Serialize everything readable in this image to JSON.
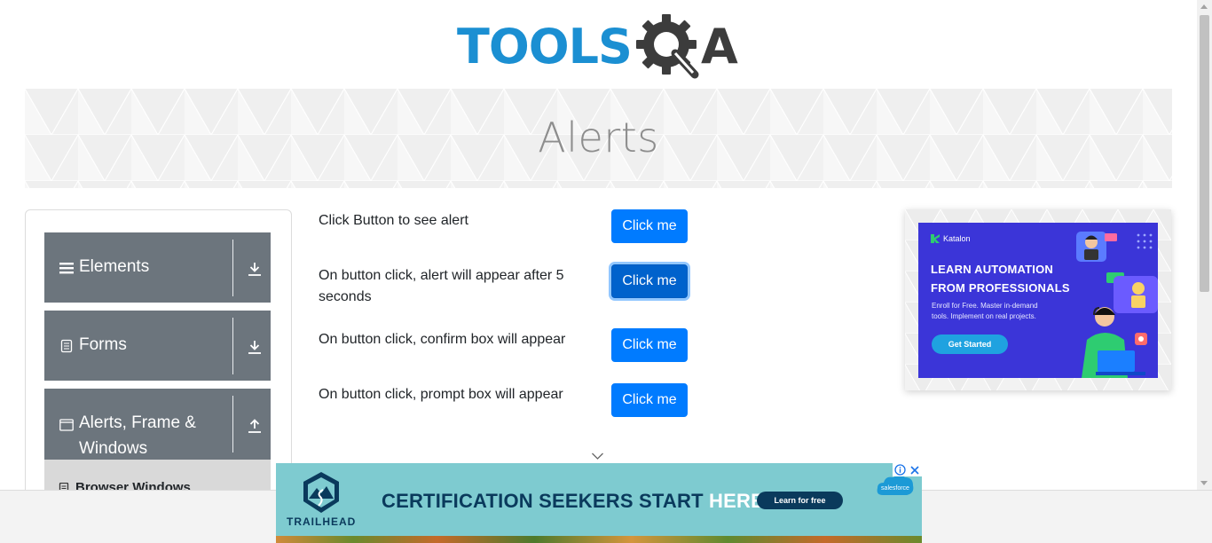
{
  "logo": {
    "tools": "TOOLS",
    "a": "A"
  },
  "banner": {
    "title": "Alerts"
  },
  "sidebar": {
    "groups": [
      {
        "label": "Elements",
        "icon": "hamburger-icon",
        "toggle": "download-arrow-icon"
      },
      {
        "label": "Forms",
        "icon": "document-icon",
        "toggle": "download-arrow-icon"
      },
      {
        "label": "Alerts, Frame & Windows",
        "icon": "window-icon",
        "toggle": "upload-arrow-icon"
      }
    ],
    "active_item": {
      "label": "Browser Windows",
      "icon": "document-icon"
    }
  },
  "rows": [
    {
      "text": "Click Button to see alert",
      "button": "Click me"
    },
    {
      "text": "On button click, alert will appear after 5 seconds",
      "button": "Click me"
    },
    {
      "text": "On button click, confirm box will appear",
      "button": "Click me"
    },
    {
      "text": "On button click, prompt box will appear",
      "button": "Click me"
    }
  ],
  "ad_right": {
    "brand": "Katalon",
    "headline": "LEARN AUTOMATION FROM PROFESSIONALS",
    "sub": "Enroll for Free. Master in-demand tools. Implement on real projects.",
    "cta": "Get Started",
    "colors": {
      "card": "#3b35d8",
      "cta": "#1fa2e0"
    }
  },
  "ad_bottom": {
    "brand": "TRAILHEAD",
    "headline_main": "CERTIFICATION SEEKERS START ",
    "headline_here": "HERE.",
    "cta": "Learn for free",
    "sponsor": "salesforce",
    "info_icon": "info-icon",
    "close_icon": "close-icon"
  },
  "colors": {
    "primary": "#007bff",
    "sidebar": "#6c757d",
    "logo_blue": "#1b8fd2"
  }
}
